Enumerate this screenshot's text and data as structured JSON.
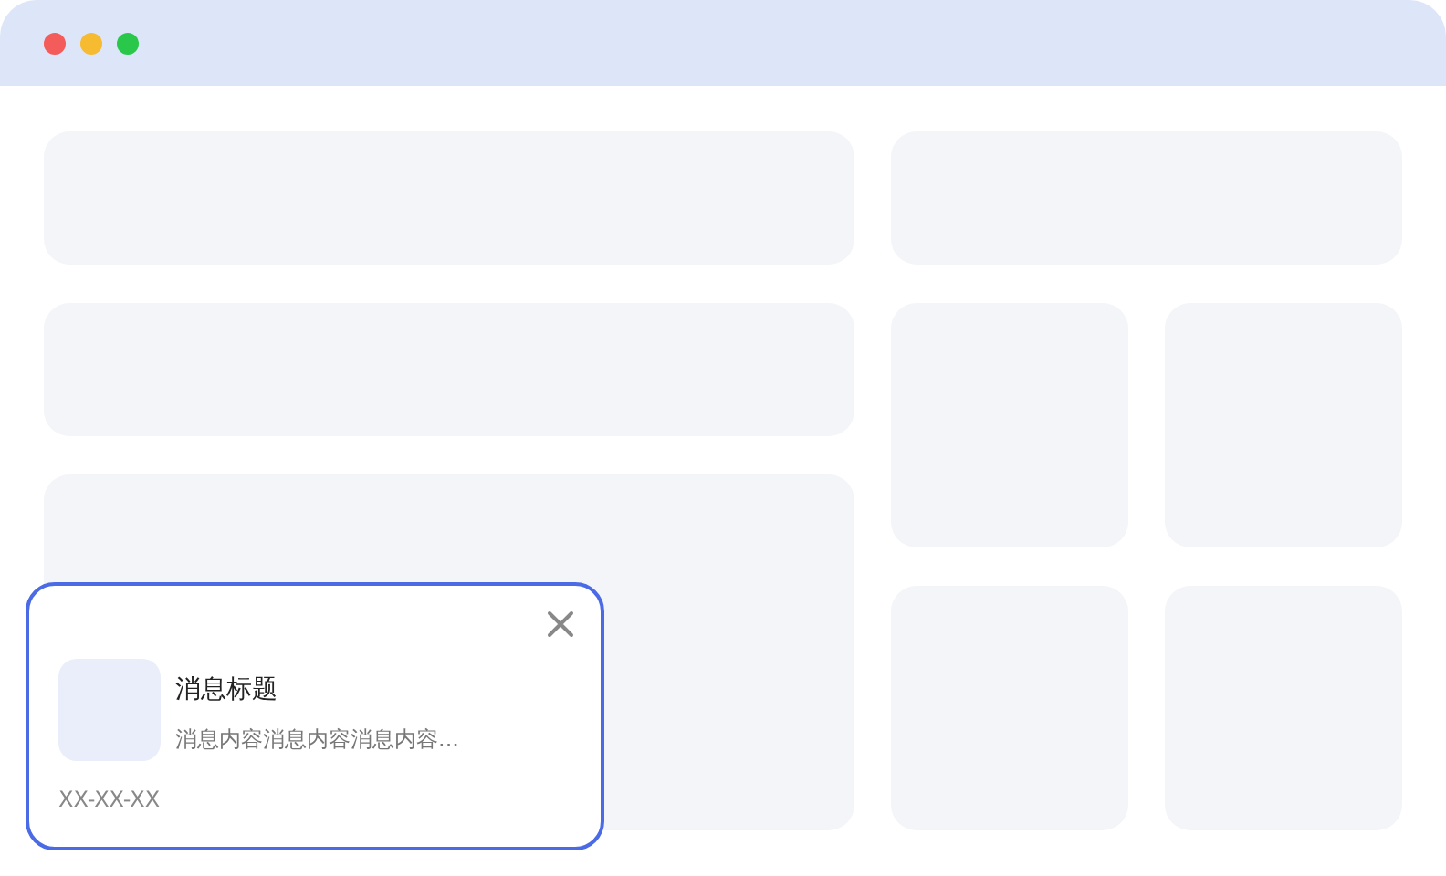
{
  "notification": {
    "title": "消息标题",
    "message": "消息内容消息内容消息内容...",
    "date": "XX-XX-XX"
  }
}
